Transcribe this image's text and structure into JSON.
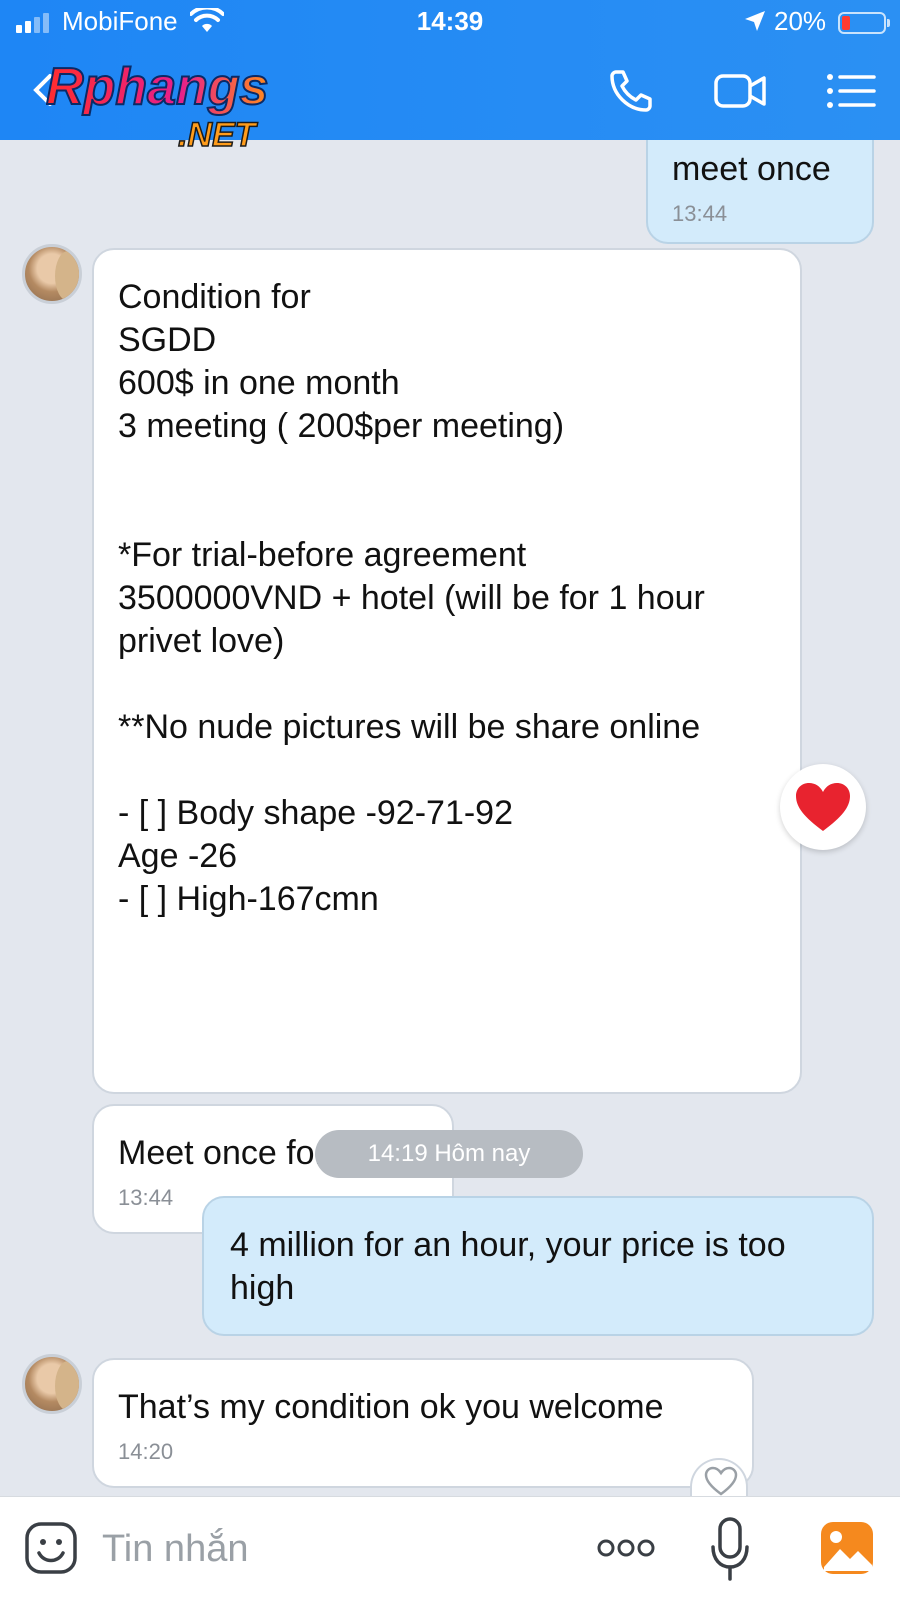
{
  "status_bar": {
    "carrier": "MobiFone",
    "time": "14:39",
    "battery": "20%",
    "battery_level": 0.2,
    "battery_color": "#ff3b30"
  },
  "header": {
    "logo_main": "Rphangs",
    "logo_sub": ".NET",
    "icons": [
      "back-icon",
      "phone-icon",
      "video-call-icon",
      "menu-list-icon"
    ],
    "accent": "#1e86f5"
  },
  "messages": [
    {
      "side": "out",
      "text": "meet once",
      "time": "13:44"
    },
    {
      "side": "in",
      "text": "Condition for \nSGDD\n600$ in one month\n3 meeting ( 200$per meeting)\n\n\n*For trial-before agreement \n3500000VND + hotel (will be for 1 hour privet love)\n\n**No nude pictures will be share online\n\n- [ ] Body shape -92-71-92\nAge -26\n- [ ] High-167cmn",
      "reaction": "❤️"
    },
    {
      "side": "in",
      "text": "Meet once for trial",
      "time": "13:44"
    },
    {
      "side": "out",
      "text": "4 million for an hour, your price is too high"
    },
    {
      "side": "in",
      "text": "That’s my condition ok you welcome",
      "time": "14:20"
    }
  ],
  "date_separator": "14:19 Hôm nay",
  "input": {
    "placeholder": "Tin nhắn",
    "value": "",
    "icons": [
      "emoji-icon",
      "more-dots-icon",
      "microphone-icon",
      "image-icon"
    ]
  }
}
